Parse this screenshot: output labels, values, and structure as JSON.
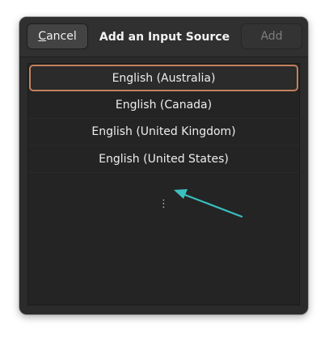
{
  "dialog": {
    "title": "Add an Input Source",
    "cancel_mnemonic": "C",
    "cancel_rest": "ancel",
    "add_label": "Add"
  },
  "list": {
    "items": [
      {
        "label": "English (Australia)",
        "selected": true
      },
      {
        "label": "English (Canada)",
        "selected": false
      },
      {
        "label": "English (United Kingdom)",
        "selected": false
      },
      {
        "label": "English (United States)",
        "selected": false
      }
    ],
    "more_glyph": "⋮"
  },
  "annotation": {
    "arrow_color": "#3bbfbf",
    "icon": "arrow-icon"
  }
}
